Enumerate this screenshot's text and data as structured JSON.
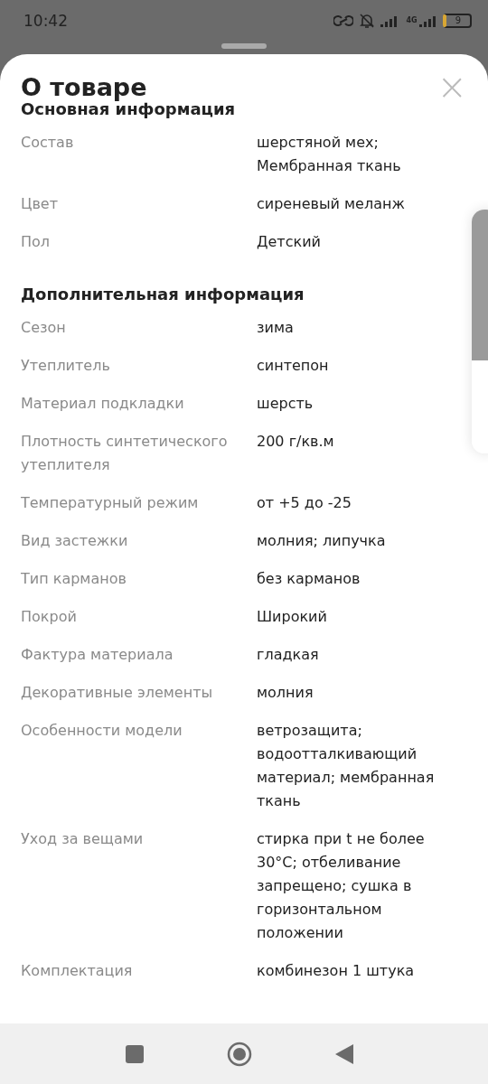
{
  "status_bar": {
    "time": "10:42",
    "network": "4G",
    "battery": "9"
  },
  "sheet": {
    "title": "О товаре",
    "close": "×"
  },
  "sections": [
    {
      "title": "Основная информация",
      "rows": [
        {
          "label": "Состав",
          "value": "шерстяной мех; Мембранная ткань"
        },
        {
          "label": "Цвет",
          "value": "сиреневый меланж"
        },
        {
          "label": "Пол",
          "value": "Детский"
        }
      ]
    },
    {
      "title": "Дополнительная информация",
      "rows": [
        {
          "label": "Сезон",
          "value": "зима"
        },
        {
          "label": "Утеплитель",
          "value": "синтепон"
        },
        {
          "label": "Материал подкладки",
          "value": "шерсть"
        },
        {
          "label": "Плотность синтетического утеплителя",
          "value": "200 г/кв.м"
        },
        {
          "label": "Температурный режим",
          "value": "от +5 до -25"
        },
        {
          "label": "Вид застежки",
          "value": "молния; липучка"
        },
        {
          "label": "Тип карманов",
          "value": "без карманов"
        },
        {
          "label": "Покрой",
          "value": "Широкий"
        },
        {
          "label": "Фактура материала",
          "value": "гладкая"
        },
        {
          "label": "Декоративные элементы",
          "value": "молния"
        },
        {
          "label": "Особенности модели",
          "value": "ветрозащита; водоотталкивающий материал; мембранная ткань"
        },
        {
          "label": "Уход за вещами",
          "value": "стирка при t не более 30°C; отбеливание запрещено; сушка в горизонтальном положении"
        },
        {
          "label": "Комплектация",
          "value": "комбинезон 1 штука"
        }
      ]
    }
  ]
}
